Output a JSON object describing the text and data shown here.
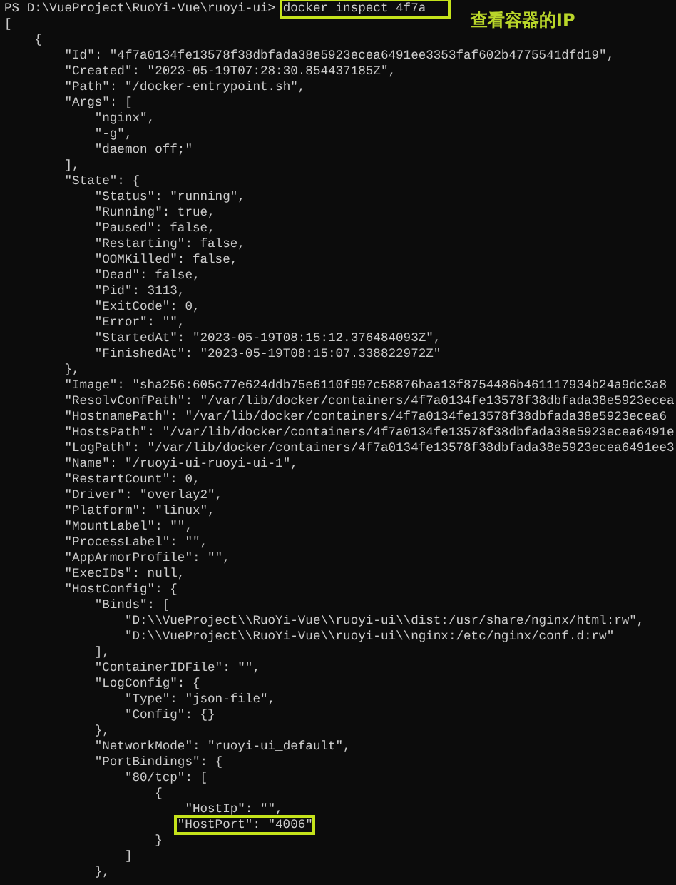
{
  "prompt": {
    "path": "PS D:\\VueProject\\RuoYi-Vue\\ruoyi-ui> ",
    "command": "docker inspect 4f7a",
    "command_boxed": true
  },
  "annotation": {
    "text": "查看容器的IP"
  },
  "lines": [
    {
      "kind": "plain",
      "text": "["
    },
    {
      "kind": "plain",
      "text": "    {"
    },
    {
      "kind": "plain",
      "text": "        \"Id\": \"4f7a0134fe13578f38dbfada38e5923ecea6491ee3353faf602b4775541dfd19\","
    },
    {
      "kind": "plain",
      "text": "        \"Created\": \"2023-05-19T07:28:30.854437185Z\","
    },
    {
      "kind": "plain",
      "text": "        \"Path\": \"/docker-entrypoint.sh\","
    },
    {
      "kind": "plain",
      "text": "        \"Args\": ["
    },
    {
      "kind": "plain",
      "text": "            \"nginx\","
    },
    {
      "kind": "plain",
      "text": "            \"-g\","
    },
    {
      "kind": "plain",
      "text": "            \"daemon off;\""
    },
    {
      "kind": "plain",
      "text": "        ],"
    },
    {
      "kind": "plain",
      "text": "        \"State\": {"
    },
    {
      "kind": "plain",
      "text": "            \"Status\": \"running\","
    },
    {
      "kind": "plain",
      "text": "            \"Running\": true,"
    },
    {
      "kind": "plain",
      "text": "            \"Paused\": false,"
    },
    {
      "kind": "plain",
      "text": "            \"Restarting\": false,"
    },
    {
      "kind": "plain",
      "text": "            \"OOMKilled\": false,"
    },
    {
      "kind": "plain",
      "text": "            \"Dead\": false,"
    },
    {
      "kind": "plain",
      "text": "            \"Pid\": 3113,"
    },
    {
      "kind": "plain",
      "text": "            \"ExitCode\": 0,"
    },
    {
      "kind": "plain",
      "text": "            \"Error\": \"\","
    },
    {
      "kind": "plain",
      "text": "            \"StartedAt\": \"2023-05-19T08:15:12.376484093Z\","
    },
    {
      "kind": "plain",
      "text": "            \"FinishedAt\": \"2023-05-19T08:15:07.338822972Z\""
    },
    {
      "kind": "plain",
      "text": "        },"
    },
    {
      "kind": "plain",
      "text": "        \"Image\": \"sha256:605c77e624ddb75e6110f997c58876baa13f8754486b461117934b24a9dc3a8"
    },
    {
      "kind": "plain",
      "text": "        \"ResolvConfPath\": \"/var/lib/docker/containers/4f7a0134fe13578f38dbfada38e5923ecea"
    },
    {
      "kind": "plain",
      "text": "        \"HostnamePath\": \"/var/lib/docker/containers/4f7a0134fe13578f38dbfada38e5923ecea6"
    },
    {
      "kind": "plain",
      "text": "        \"HostsPath\": \"/var/lib/docker/containers/4f7a0134fe13578f38dbfada38e5923ecea6491e"
    },
    {
      "kind": "plain",
      "text": "        \"LogPath\": \"/var/lib/docker/containers/4f7a0134fe13578f38dbfada38e5923ecea6491ee3"
    },
    {
      "kind": "plain",
      "text": "        \"Name\": \"/ruoyi-ui-ruoyi-ui-1\","
    },
    {
      "kind": "plain",
      "text": "        \"RestartCount\": 0,"
    },
    {
      "kind": "plain",
      "text": "        \"Driver\": \"overlay2\","
    },
    {
      "kind": "plain",
      "text": "        \"Platform\": \"linux\","
    },
    {
      "kind": "plain",
      "text": "        \"MountLabel\": \"\","
    },
    {
      "kind": "plain",
      "text": "        \"ProcessLabel\": \"\","
    },
    {
      "kind": "plain",
      "text": "        \"AppArmorProfile\": \"\","
    },
    {
      "kind": "plain",
      "text": "        \"ExecIDs\": null,"
    },
    {
      "kind": "plain",
      "text": "        \"HostConfig\": {"
    },
    {
      "kind": "plain",
      "text": "            \"Binds\": ["
    },
    {
      "kind": "plain",
      "text": "                \"D:\\\\VueProject\\\\RuoYi-Vue\\\\ruoyi-ui\\\\dist:/usr/share/nginx/html:rw\","
    },
    {
      "kind": "plain",
      "text": "                \"D:\\\\VueProject\\\\RuoYi-Vue\\\\ruoyi-ui\\\\nginx:/etc/nginx/conf.d:rw\""
    },
    {
      "kind": "plain",
      "text": "            ],"
    },
    {
      "kind": "plain",
      "text": "            \"ContainerIDFile\": \"\","
    },
    {
      "kind": "plain",
      "text": "            \"LogConfig\": {"
    },
    {
      "kind": "plain",
      "text": "                \"Type\": \"json-file\","
    },
    {
      "kind": "plain",
      "text": "                \"Config\": {}"
    },
    {
      "kind": "plain",
      "text": "            },"
    },
    {
      "kind": "plain",
      "text": "            \"NetworkMode\": \"ruoyi-ui_default\","
    },
    {
      "kind": "plain",
      "text": "            \"PortBindings\": {"
    },
    {
      "kind": "plain",
      "text": "                \"80/tcp\": ["
    },
    {
      "kind": "plain",
      "text": "                    {"
    },
    {
      "kind": "plain",
      "text": "                        \"HostIp\": \"\","
    },
    {
      "kind": "boxed",
      "text": "\"HostPort\": \"4006\""
    },
    {
      "kind": "plain",
      "text": "                    }"
    },
    {
      "kind": "plain",
      "text": "                ]"
    },
    {
      "kind": "plain",
      "text": "            },"
    }
  ]
}
